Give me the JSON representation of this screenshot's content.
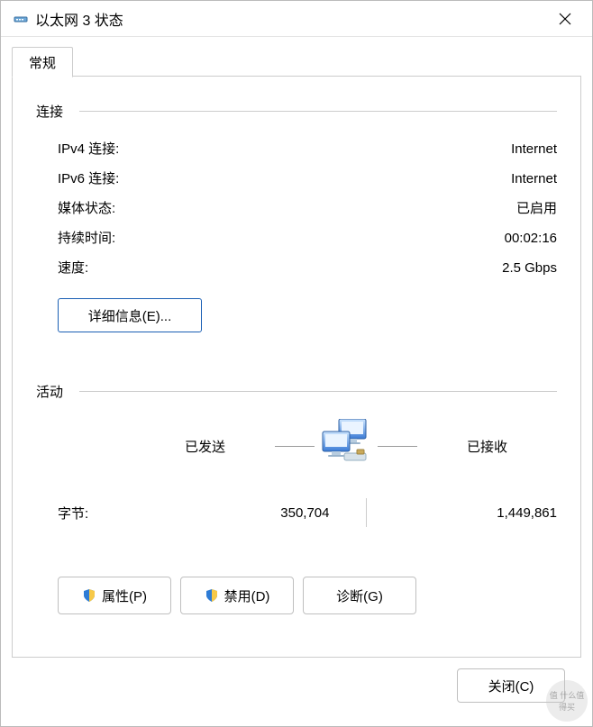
{
  "window": {
    "title": "以太网 3 状态",
    "icon": "network-adapter-icon",
    "close": "✕"
  },
  "tabs": {
    "general": "常规"
  },
  "connection": {
    "header": "连接",
    "rows": {
      "ipv4": {
        "label": "IPv4 连接:",
        "value": "Internet"
      },
      "ipv6": {
        "label": "IPv6 连接:",
        "value": "Internet"
      },
      "media": {
        "label": "媒体状态:",
        "value": "已启用"
      },
      "duration": {
        "label": "持续时间:",
        "value": "00:02:16"
      },
      "speed": {
        "label": "速度:",
        "value": "2.5 Gbps"
      }
    },
    "details_button": "详细信息(E)..."
  },
  "activity": {
    "header": "活动",
    "sent_label": "已发送",
    "recv_label": "已接收",
    "icon": "network-computers-icon",
    "bytes_label": "字节:",
    "bytes_sent": "350,704",
    "bytes_recv": "1,449,861"
  },
  "buttons": {
    "properties": "属性(P)",
    "disable": "禁用(D)",
    "diagnose": "诊断(G)",
    "close": "关闭(C)"
  },
  "watermark": "值 什么值得买"
}
